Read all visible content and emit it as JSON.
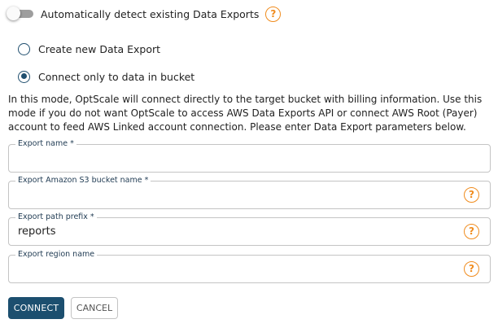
{
  "auto_detect": {
    "label": "Automatically detect existing Data Exports",
    "enabled": false
  },
  "modes": [
    {
      "label": "Create new Data Export",
      "selected": false
    },
    {
      "label": "Connect only to data in bucket",
      "selected": true
    }
  ],
  "description": "In this mode, OptScale will connect directly to the target bucket with billing information. Use this mode if you do not want OptScale to access AWS Data Exports API or connect AWS Root (Payer) account to feed AWS Linked account connection. Please enter Data Export parameters below.",
  "fields": {
    "export_name": {
      "label": "Export name *",
      "value": ""
    },
    "bucket_name": {
      "label": "Export Amazon S3 bucket name *",
      "value": ""
    },
    "path_prefix": {
      "label": "Export path prefix *",
      "value": "reports"
    },
    "region_name": {
      "label": "Export region name",
      "value": ""
    }
  },
  "help_glyph": "?",
  "buttons": {
    "connect": "CONNECT",
    "cancel": "CANCEL"
  },
  "colors": {
    "primary": "#1c4f6f",
    "help_accent": "#f08c1e"
  },
  "icons": {
    "help": "help-circle-icon",
    "toggle": "toggle-switch"
  }
}
